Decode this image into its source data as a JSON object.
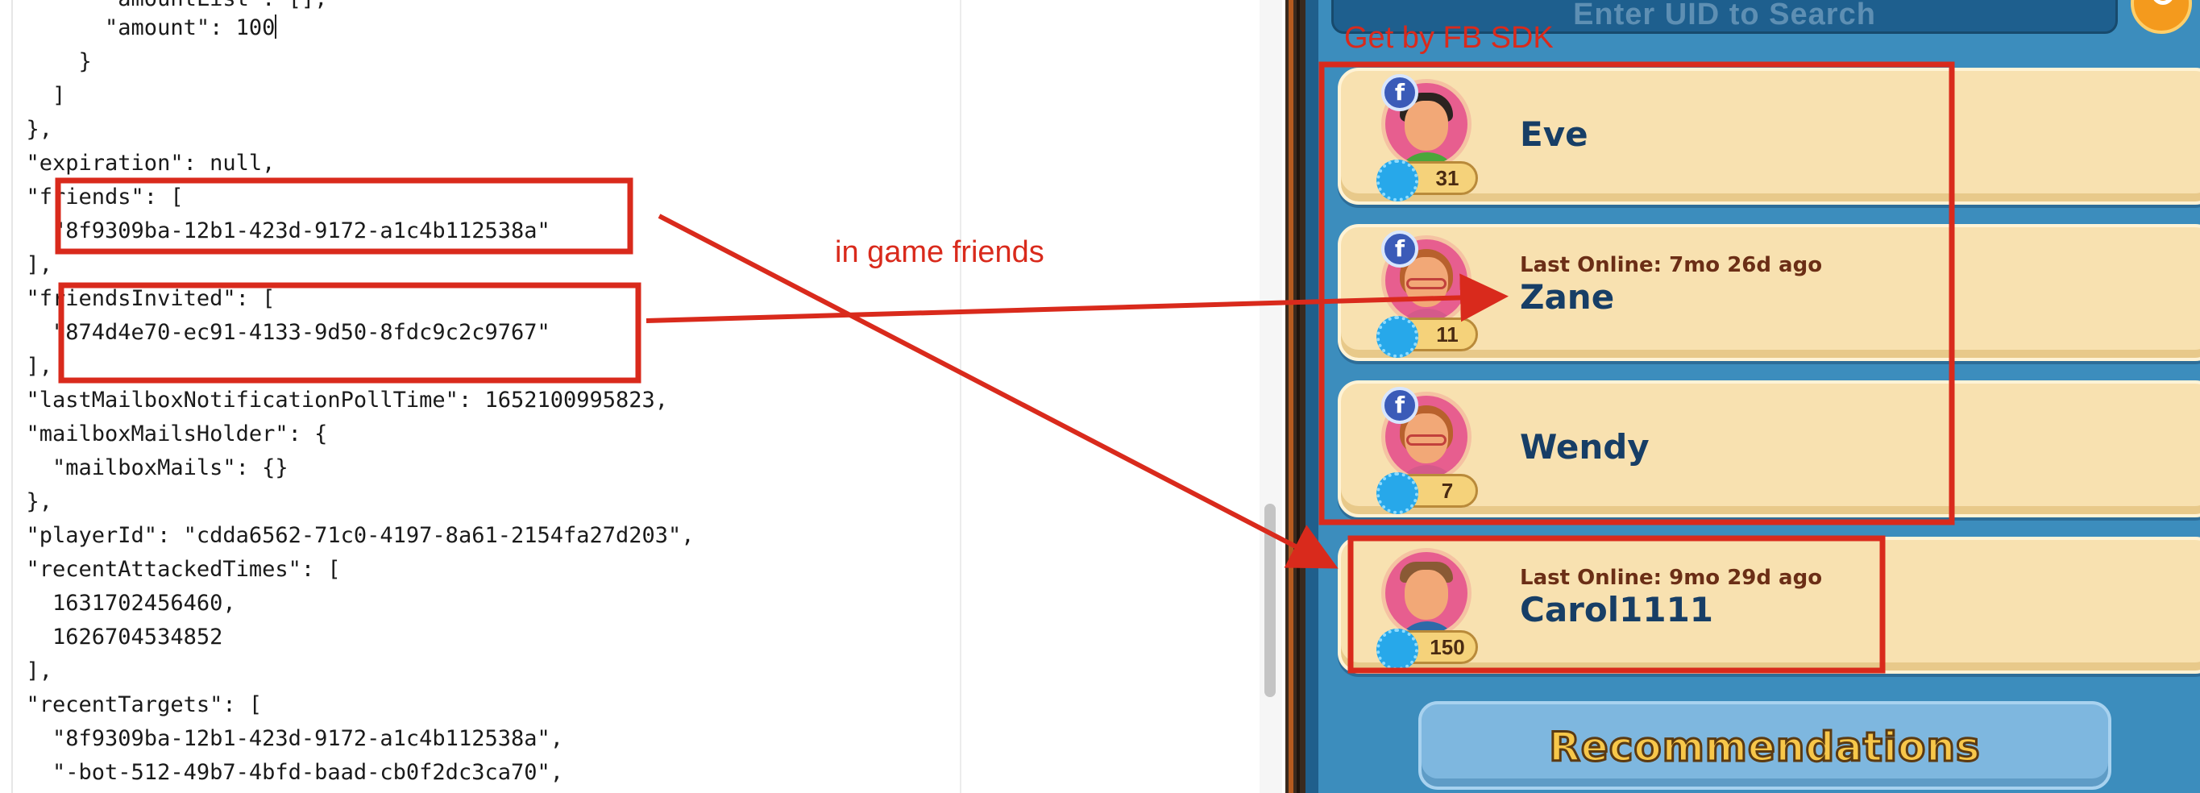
{
  "editor": {
    "lines": [
      "        \"amountList\": [],",
      "        \"amount\": 100",
      "      }",
      "    ]",
      "  },",
      "  \"expiration\": null,",
      "  \"friends\": [",
      "    \"8f9309ba-12b1-423d-9172-a1c4b112538a\"",
      "  ],",
      "  \"friendsInvited\": [",
      "    \"874d4e70-ec91-4133-9d50-8fdc9c2c9767\"",
      "  ],",
      "  \"lastMailboxNotificationPollTime\": 1652100995823,",
      "  \"mailboxMailsHolder\": {",
      "    \"mailboxMails\": {}",
      "  },",
      "  \"playerId\": \"cdda6562-71c0-4197-8a61-2154fa27d203\",",
      "  \"recentAttackedTimes\": [",
      "    1631702456460,",
      "    1626704534852",
      "  ],",
      "  \"recentTargets\": [",
      "    \"8f9309ba-12b1-423d-9172-a1c4b112538a\",",
      "    \"-bot-512-49b7-4bfd-baad-cb0f2dc3ca70\","
    ]
  },
  "game": {
    "search_placeholder": "Enter UID to Search",
    "search_icon": "magnifier-icon",
    "friends": [
      {
        "name": "Eve",
        "level": "31",
        "last_online": "",
        "facebook": true,
        "avatar": "boy-dark-hair"
      },
      {
        "name": "Zane",
        "level": "11",
        "last_online": "Last Online: 7mo 26d ago",
        "facebook": true,
        "avatar": "girl-red-hair-glasses"
      },
      {
        "name": "Wendy",
        "level": "7",
        "last_online": "",
        "facebook": true,
        "avatar": "girl-red-hair-glasses"
      },
      {
        "name": "Carol1111",
        "level": "150",
        "last_online": "Last Online: 9mo 29d ago",
        "facebook": false,
        "avatar": "boy-brown-hair"
      }
    ],
    "recommend_label": "Recommendations"
  },
  "annotations": {
    "fb_sdk_label": "Get by FB SDK",
    "in_game_label": "in game friends",
    "color": "#d92a1c"
  }
}
